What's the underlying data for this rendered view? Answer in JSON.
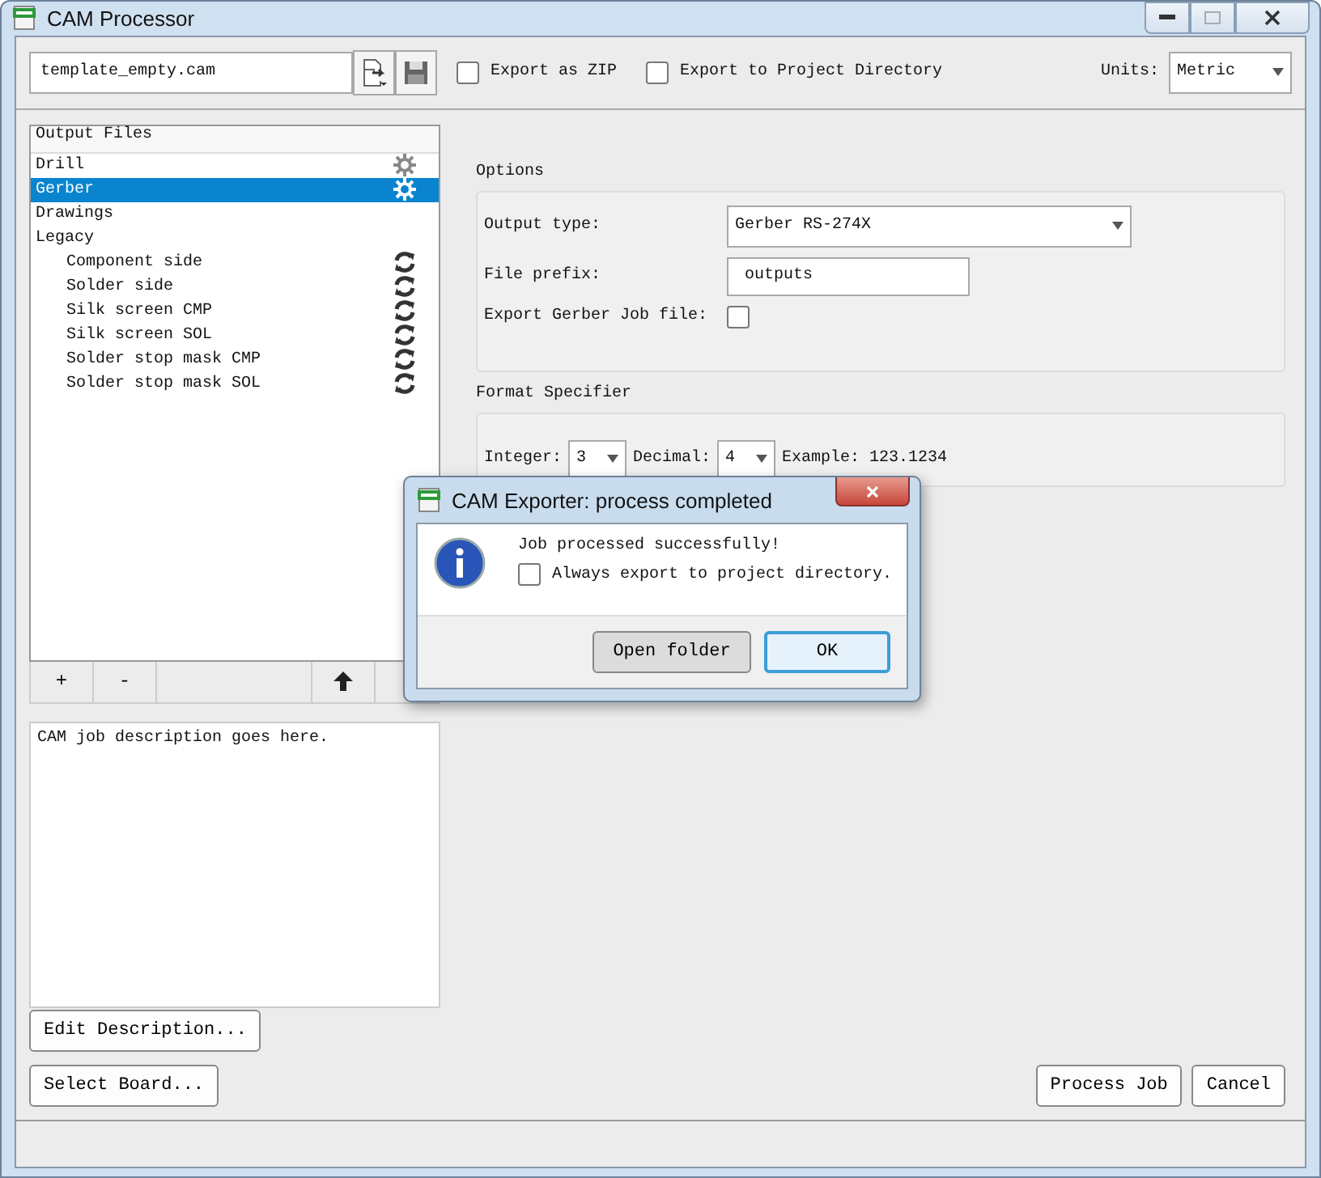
{
  "window": {
    "title": "CAM Processor"
  },
  "toolbar": {
    "job_file": "template_empty.cam",
    "export_zip": {
      "label": "Export as ZIP",
      "checked": false
    },
    "export_project": {
      "label": "Export to Project Directory",
      "checked": false
    },
    "units_label": "Units:",
    "units": "Metric"
  },
  "output_files": {
    "header": "Output Files",
    "items": [
      {
        "label": "Drill",
        "kind": "gear",
        "selected": false
      },
      {
        "label": "Gerber",
        "kind": "gear",
        "selected": true
      },
      {
        "label": "Drawings",
        "selected": false
      },
      {
        "label": "Legacy",
        "selected": false,
        "children": [
          {
            "label": "Component side",
            "kind": "refresh",
            "selected": false
          },
          {
            "label": "Solder side",
            "kind": "refresh",
            "selected": false
          },
          {
            "label": "Silk screen CMP",
            "kind": "refresh",
            "selected": false
          },
          {
            "label": "Silk screen SOL",
            "kind": "refresh",
            "selected": false
          },
          {
            "label": "Solder stop mask CMP",
            "kind": "refresh",
            "selected": false
          },
          {
            "label": "Solder stop mask SOL",
            "kind": "refresh",
            "selected": false
          }
        ]
      }
    ]
  },
  "list_buttons": {
    "add": "+",
    "remove": "-"
  },
  "description": "CAM job description goes here.",
  "edit_description": "Edit Description...",
  "select_board": "Select Board...",
  "options": {
    "title": "Options",
    "output_type_label": "Output type:",
    "output_type": "Gerber RS-274X",
    "file_prefix_label": "File prefix:",
    "file_prefix": "outputs",
    "job_file_label": "Export Gerber Job file:",
    "job_file_checked": false
  },
  "format": {
    "title": "Format Specifier",
    "integer_label": "Integer:",
    "integer": "3",
    "decimal_label": "Decimal:",
    "decimal": "4",
    "example": "Example: 123.1234"
  },
  "process_job": "Process Job",
  "cancel": "Cancel",
  "dialog": {
    "title": "CAM Exporter: process completed",
    "message": "Job processed successfully!",
    "always_export": {
      "label": "Always export to project directory.",
      "checked": false
    },
    "buttons": [
      {
        "label": "Open folder",
        "default": false
      },
      {
        "label": "OK",
        "default": true
      }
    ]
  }
}
